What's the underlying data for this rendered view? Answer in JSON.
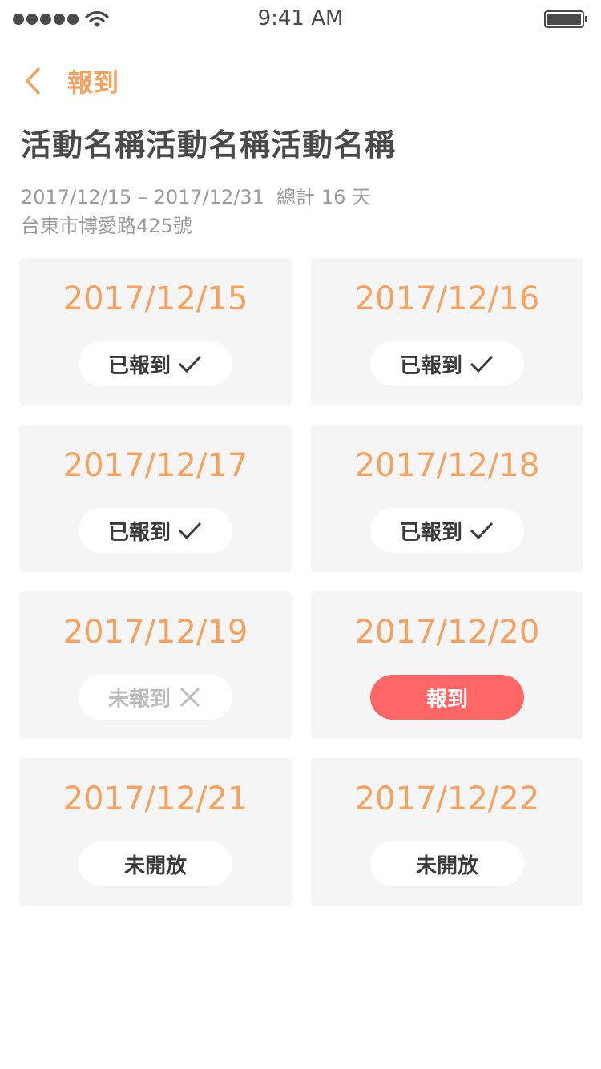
{
  "status_bar": {
    "time": "9:41 AM"
  },
  "nav": {
    "back_label": "報到"
  },
  "event": {
    "title": "活動名稱活動名稱活動名稱",
    "date_range": "2017/12/15 – 2017/12/31  總計 16 天",
    "address": "台東市博愛路425號"
  },
  "colors": {
    "accent": "#f5a15f",
    "checkin": "#ff6767",
    "card_bg": "#f5f5f5",
    "muted": "#9b9b9b"
  },
  "days": [
    {
      "date": "2017/12/15",
      "button": "已報到",
      "state": "checked",
      "icon": "check-icon"
    },
    {
      "date": "2017/12/16",
      "button": "已報到",
      "state": "checked",
      "icon": "check-icon"
    },
    {
      "date": "2017/12/17",
      "button": "已報到",
      "state": "checked",
      "icon": "check-icon"
    },
    {
      "date": "2017/12/18",
      "button": "已報到",
      "state": "checked",
      "icon": "check-icon"
    },
    {
      "date": "2017/12/19",
      "button": "未報到",
      "state": "missed",
      "icon": "x-icon"
    },
    {
      "date": "2017/12/20",
      "button": "報到",
      "state": "active"
    },
    {
      "date": "2017/12/21",
      "button": "未開放",
      "state": "closed"
    },
    {
      "date": "2017/12/22",
      "button": "未開放",
      "state": "closed"
    }
  ]
}
